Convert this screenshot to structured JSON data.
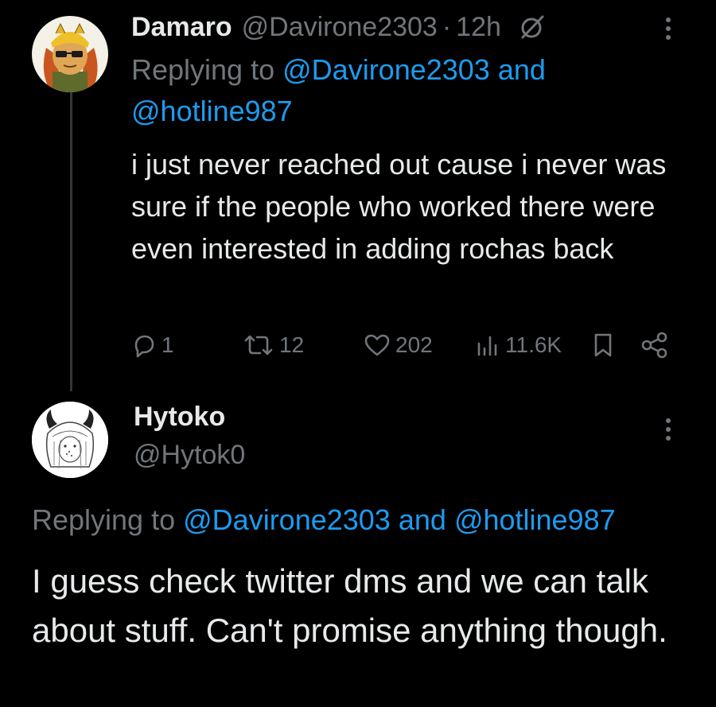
{
  "tweet1": {
    "display_name": "Damaro",
    "handle": "@Davirone2303",
    "separator": "·",
    "time": "12h",
    "replying_prefix": "Replying to",
    "mention_1": "@Davirone2303",
    "and_text": "and",
    "mention_2": "@hotline987",
    "text": "i just never reached out cause i never was sure if the people who worked there were even interested in adding rochas back",
    "replies": "1",
    "retweets": "12",
    "likes": "202",
    "views": "11.6K"
  },
  "tweet2": {
    "display_name": "Hytoko",
    "handle": "@Hytok0",
    "replying_prefix": "Replying to",
    "mention_1": "@Davirone2303",
    "and_text": "and",
    "mention_2": "@hotline987",
    "text": "I guess check twitter dms and we can talk about stuff. Can't promise anything though."
  },
  "colors": {
    "background": "#000000",
    "primary_text": "#e7e9ea",
    "secondary_text": "#71767b",
    "link": "#1d9bf0"
  },
  "icons": [
    "mute-icon",
    "more-icon",
    "reply-icon",
    "retweet-icon",
    "like-icon",
    "views-icon",
    "bookmark-icon",
    "share-icon"
  ]
}
